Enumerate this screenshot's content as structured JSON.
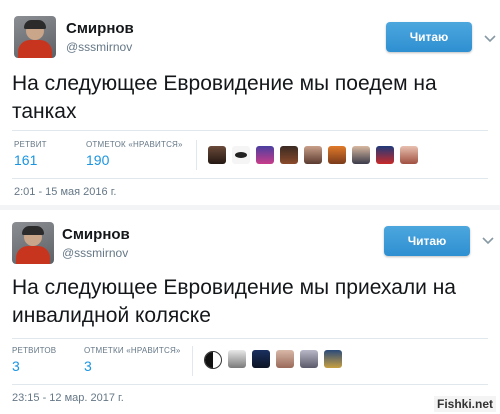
{
  "tweets": [
    {
      "author": {
        "name": "Смирнов",
        "handle": "@sssmirnov"
      },
      "follow_label": "Читаю",
      "text": "На следующее Евровидение мы поедем на танках",
      "stats": {
        "retweets_label": "РЕТВИТ",
        "retweets": "161",
        "likes_label": "ОТМЕТОК «НРАВИТСЯ»",
        "likes": "190"
      },
      "timestamp": "2:01 - 15 мая 2016 г."
    },
    {
      "author": {
        "name": "Смирнов",
        "handle": "@sssmirnov"
      },
      "follow_label": "Читаю",
      "text": "На следующее Евровидение мы приехали на инвалидной коляске",
      "stats": {
        "retweets_label": "РЕТВИТОВ",
        "retweets": "3",
        "likes_label": "ОТМЕТКИ «НРАВИТСЯ»",
        "likes": "3"
      },
      "timestamp": "23:15 - 12 мар. 2017 г."
    }
  ],
  "watermark": "Fishki.net",
  "colors": {
    "follow": "#2e8fd1",
    "link": "#1b95e0",
    "muted": "#657786"
  }
}
